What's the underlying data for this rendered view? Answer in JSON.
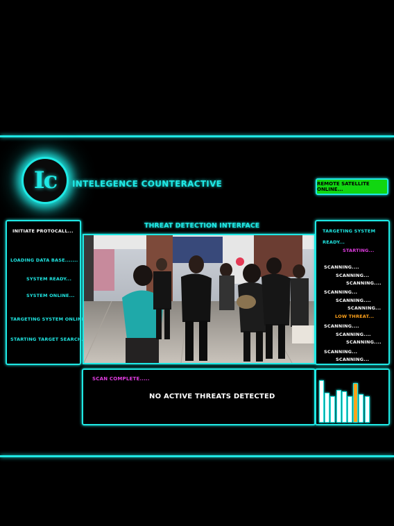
{
  "logo": {
    "text": "Ic"
  },
  "brand": {
    "title": "INTELEGENCE COUNTERACTIVE"
  },
  "satellite": {
    "label": "REMOTE SATELLITE ONLINE..."
  },
  "interface": {
    "title": "THREAT DETECTION INTERFACE"
  },
  "left_panel": {
    "lines": [
      "INITIATE PROTOCALL...",
      "LOADING DATA BASE.......",
      "SYSTEM READY...",
      "SYSTEM ONLINE...",
      "TARGETING SYSTEM ONLINE....",
      "STARTING TARGET SEARCH...."
    ]
  },
  "right_panel": {
    "lines": [
      "TARGETING SYSTEM",
      "READY...",
      "STARTING...",
      "SCANNING....",
      "SCANNING...",
      "SCANNING....",
      "SCANNING...",
      "SCANNING....",
      "SCANNING...",
      "LOW THREAT...",
      "SCANNING....",
      "SCANNING....",
      "SCANNING....",
      "SCANNING...",
      "SCANNING..."
    ]
  },
  "status": {
    "scan": "SCAN COMPLETE.....",
    "result": "NO ACTIVE THREATS DETECTED"
  },
  "meter": {
    "levels": [
      0.84,
      0.58,
      0.52,
      0.64,
      0.62,
      0.52,
      0.78,
      0.56,
      0.52
    ]
  },
  "colors": {
    "accent": "#1fe8e4",
    "magenta": "#e23ce2",
    "warning": "#ffa21a",
    "online": "#11d611"
  }
}
